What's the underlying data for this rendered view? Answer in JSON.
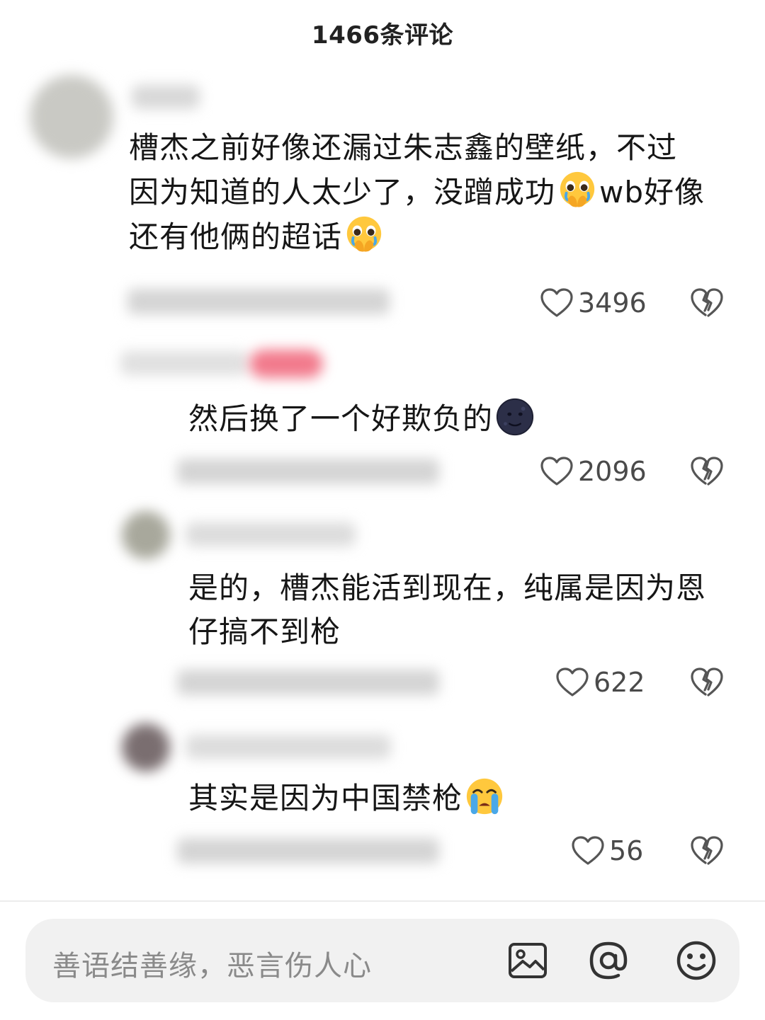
{
  "header": {
    "title": "1466条评论"
  },
  "comments": [
    {
      "line1": "槽杰之前好像还漏过朱志鑫的壁纸，不过",
      "line2_a": "因为知道的人太少了，没蹭成功",
      "line2_b": "wb好像",
      "line3": "还有他俩的超话",
      "likes": "3496"
    },
    {
      "line1": "然后换了一个好欺负的",
      "likes": "2096"
    },
    {
      "line1": "是的，槽杰能活到现在，纯属是因为恩",
      "line2": "仔搞不到枪",
      "likes": "622"
    },
    {
      "line1": "其实是因为中国禁枪",
      "likes": "56"
    }
  ],
  "icons": {
    "like": "heart-outline-icon",
    "dislike": "broken-heart-icon",
    "emoji_pleading": "pleading-face-hands-emoji",
    "emoji_moon": "new-moon-face-emoji",
    "emoji_crying": "loudly-crying-face-emoji",
    "image": "image-icon",
    "mention": "at-mention-icon",
    "smiley": "smiley-face-icon"
  },
  "input": {
    "placeholder": "善语结善缘，恶言伤人心"
  }
}
